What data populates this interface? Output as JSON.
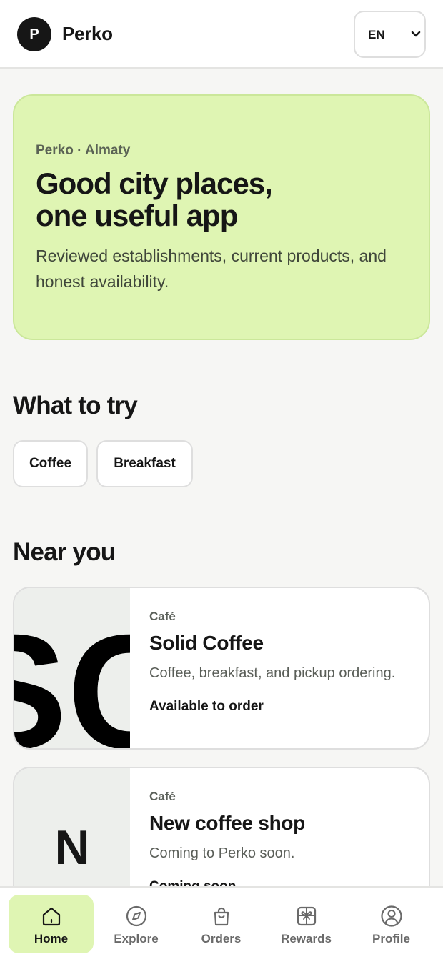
{
  "header": {
    "logo_letter": "P",
    "brand": "Perko",
    "language": "EN"
  },
  "hero": {
    "eyebrow": "Perko · Almaty",
    "title_line1": "Good city places,",
    "title_line2": "one useful app",
    "text": "Reviewed establishments, current products, and honest availability."
  },
  "try_section": {
    "title": "What to try",
    "chips": [
      {
        "label": "Coffee"
      },
      {
        "label": "Breakfast"
      }
    ]
  },
  "near_section": {
    "title": "Near you",
    "places": [
      {
        "category": "Café",
        "name": "Solid Coffee",
        "description": "Coffee, breakfast, and pickup ordering.",
        "status": "Available to order",
        "logo_text": "SC"
      },
      {
        "category": "Café",
        "name": "New coffee shop",
        "description": "Coming to Perko soon.",
        "status": "Coming soon",
        "monogram": "N"
      }
    ]
  },
  "bottom_nav": {
    "active": "Home",
    "items": [
      {
        "label": "Home",
        "icon": "home-icon"
      },
      {
        "label": "Explore",
        "icon": "compass-icon"
      },
      {
        "label": "Orders",
        "icon": "shopping-bag-icon"
      },
      {
        "label": "Rewards",
        "icon": "gift-icon"
      },
      {
        "label": "Profile",
        "icon": "user-icon"
      }
    ]
  },
  "colors": {
    "accent": "#dff5b3",
    "text": "#161616",
    "background": "#f6f6f4"
  }
}
